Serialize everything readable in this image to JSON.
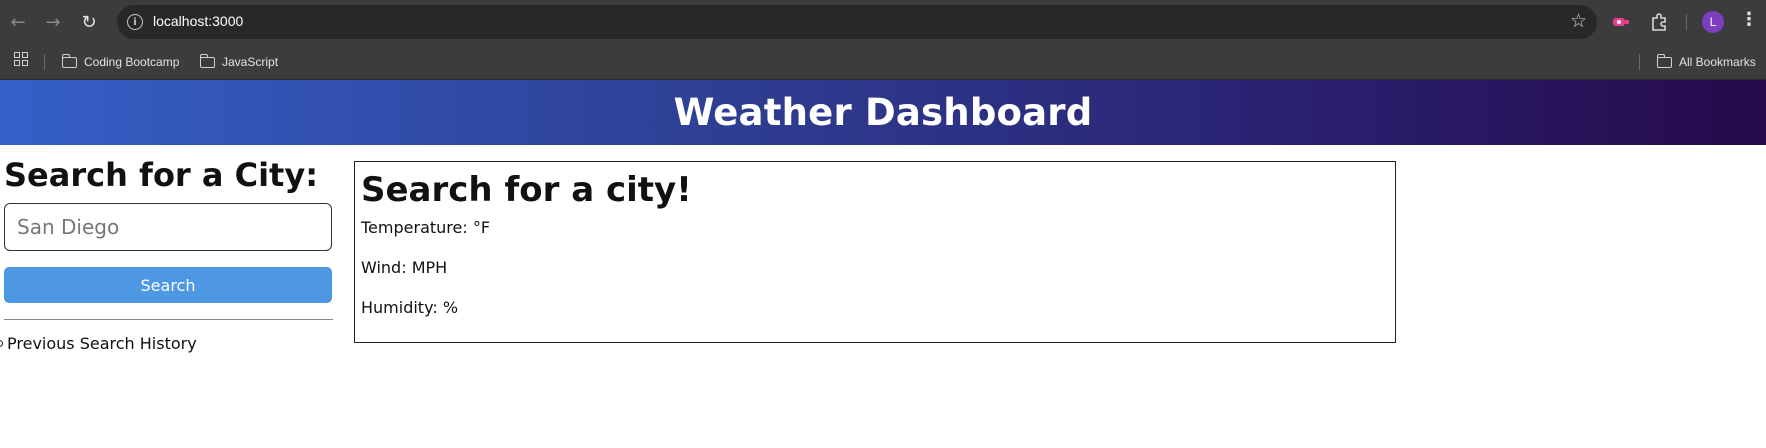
{
  "browser": {
    "url": "localhost:3000",
    "bookmarks": [
      "Coding Bootcamp",
      "JavaScript"
    ],
    "all_bookmarks_label": "All Bookmarks",
    "profile_initial": "L"
  },
  "header": {
    "title": "Weather Dashboard"
  },
  "sidebar": {
    "title": "Search for a City:",
    "input_value": "San Diego",
    "search_label": "Search",
    "history_label": "Previous Search History"
  },
  "card": {
    "title": "Search for a city!",
    "temperature": "Temperature: °F",
    "wind": "Wind: MPH",
    "humidity": "Humidity: %"
  },
  "colors": {
    "header_start": "#3560c8",
    "header_end": "#260a4a",
    "button": "#4d97e3"
  }
}
